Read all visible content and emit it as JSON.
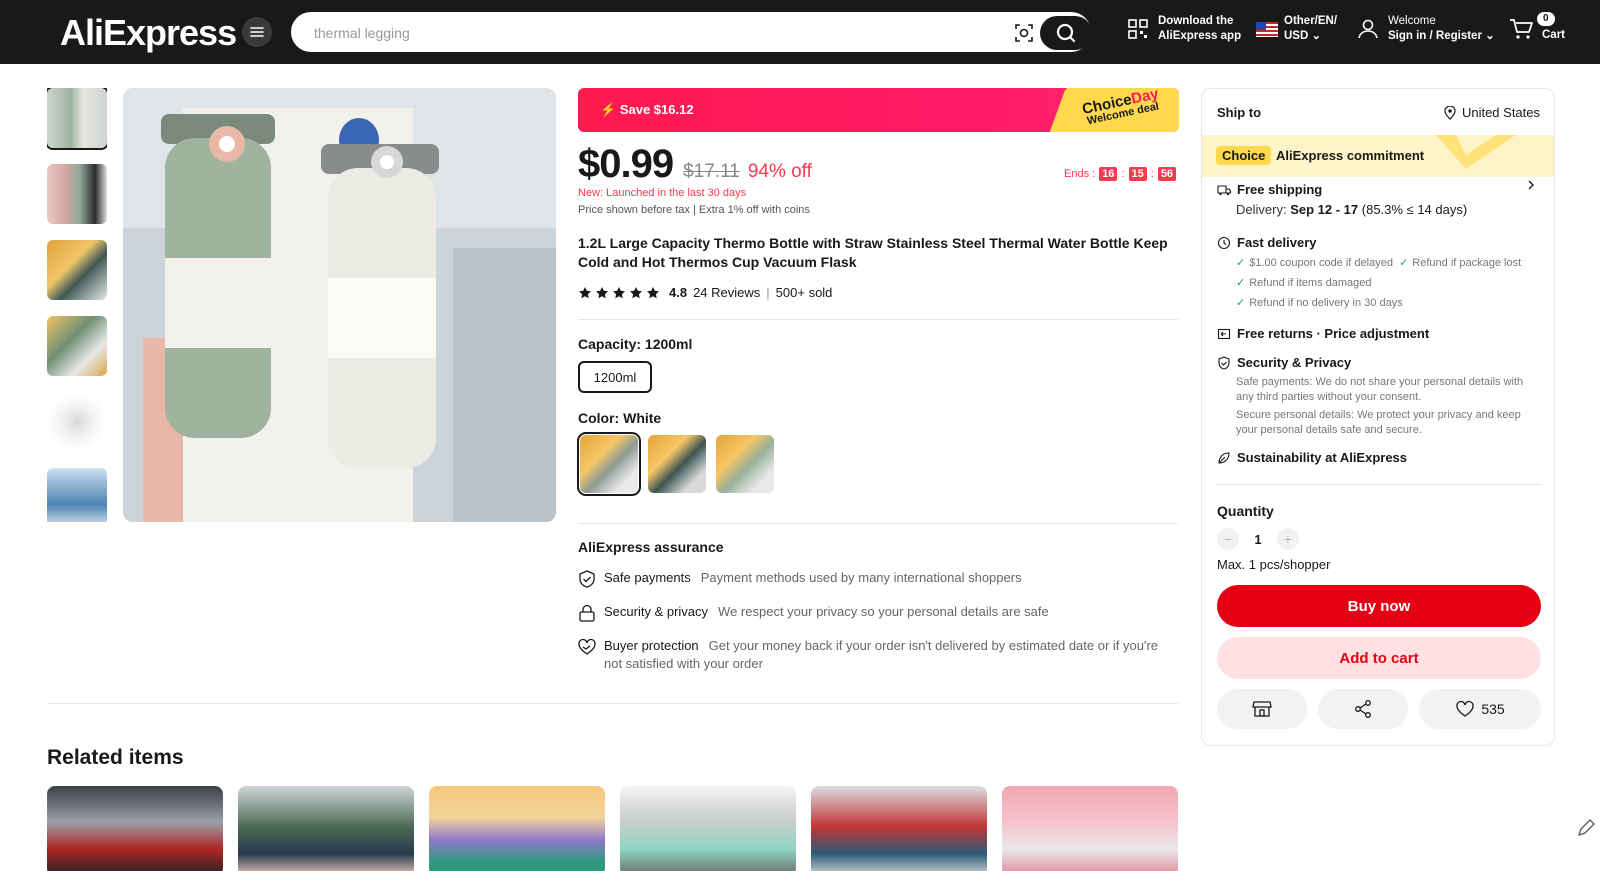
{
  "header": {
    "logo": "AliExpress",
    "search_placeholder": "thermal legging",
    "download_line1": "Download the",
    "download_line2": "AliExpress app",
    "locale_line1": "Other/EN/",
    "locale_line2": "USD",
    "welcome_line1": "Welcome",
    "welcome_line2": "Sign in / Register",
    "cart_count": "0",
    "cart_label": "Cart"
  },
  "promo": {
    "save": "Save $16.12",
    "choice_a": "Choice",
    "choice_b": "Day",
    "choice_sub": "Welcome deal"
  },
  "price": {
    "now": "$0.99",
    "old": "$17.11",
    "off": "94% off",
    "ends_label": "Ends :",
    "hh": "16",
    "mm": "15",
    "ss": "56",
    "new_launch": "New: Launched in the last 30 days",
    "tax_line": "Price shown before tax | Extra 1% off with coins"
  },
  "product": {
    "title": "1.2L Large Capacity Thermo Bottle with Straw Stainless Steel Thermal Water Bottle Keep Cold and Hot Thermos Cup Vacuum Flask",
    "rating": "4.8",
    "reviews": "24 Reviews",
    "sold": "500+ sold",
    "capacity_label": "Capacity: 1200ml",
    "capacity_option": "1200ml",
    "color_label": "Color: White"
  },
  "assurance": {
    "title": "AliExpress assurance",
    "items": [
      {
        "title": "Safe payments",
        "desc": "Payment methods used by many international shoppers"
      },
      {
        "title": "Security & privacy",
        "desc": "We respect your privacy so your personal details are safe"
      },
      {
        "title": "Buyer protection",
        "desc": "Get your money back if your order isn't delivered by estimated date or if you're not satisfied with your order"
      }
    ]
  },
  "related": {
    "title": "Related items"
  },
  "panel": {
    "ship_to": "Ship to",
    "country": "United States",
    "choice_chip": "Choice",
    "choice_commit": "AliExpress commitment",
    "free_shipping": "Free shipping",
    "delivery_label": "Delivery:",
    "delivery_dates": "Sep 12 - 17",
    "delivery_rate": "(85.3% ≤ 14 days)",
    "fast_delivery": "Fast delivery",
    "fd_items": [
      "$1.00 coupon code if delayed",
      "Refund if package lost",
      "Refund if items damaged",
      "Refund if no delivery in 30 days"
    ],
    "free_returns": "Free returns · Price adjustment",
    "security": "Security & Privacy",
    "sec_p1": "Safe payments: We do not share your personal details with any third parties without your consent.",
    "sec_p2": "Secure personal details: We protect your privacy and keep your personal details safe and secure.",
    "sustain": "Sustainability at AliExpress",
    "qty_label": "Quantity",
    "qty_value": "1",
    "qty_max": "Max. 1 pcs/shopper",
    "buy_now": "Buy now",
    "add_to_cart": "Add to cart",
    "wishlist_count": "535"
  },
  "colors": {
    "accent_red": "#e60013",
    "promo_pink": "#ff1a4f",
    "choice_yellow": "#ffd84d"
  }
}
